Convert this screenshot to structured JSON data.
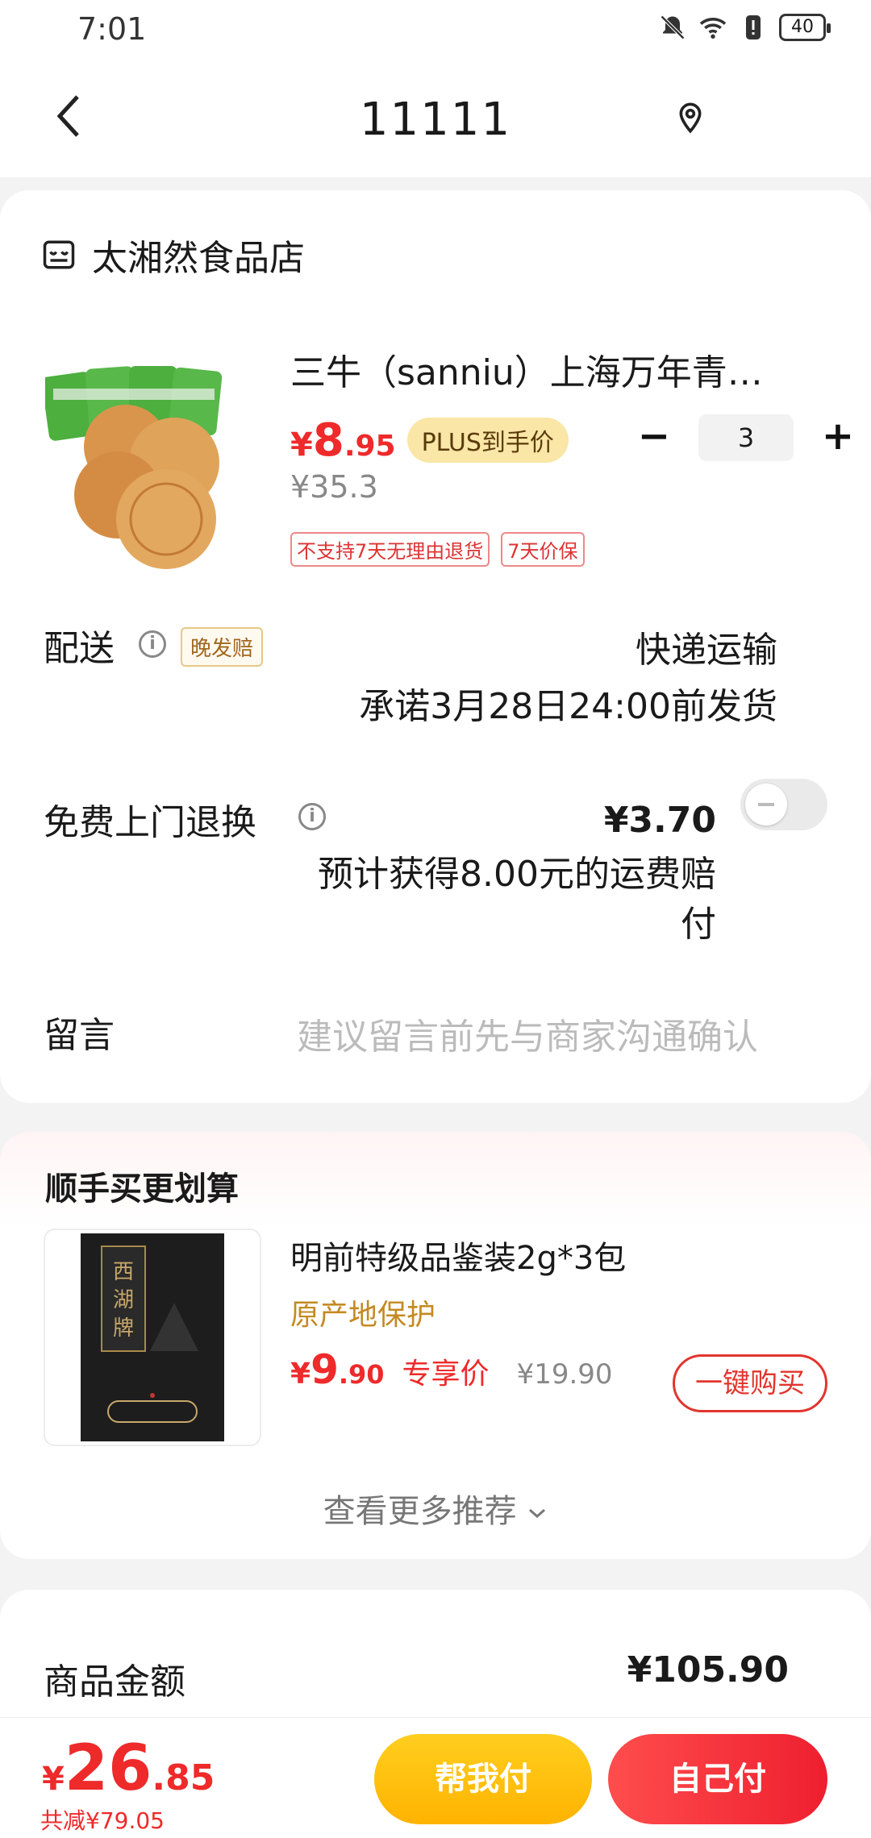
{
  "status_bar": {
    "time": "7:01",
    "battery": "40"
  },
  "nav": {
    "title": "11111"
  },
  "store": {
    "name": "太湘然食品店"
  },
  "product": {
    "title": "三牛（sanniu）上海万年青…",
    "price_currency": "¥",
    "price_int": "8",
    "price_dec": ".95",
    "plus_badge": "PLUS到手价",
    "original_price": "¥35.3",
    "quantity": "3",
    "minus": "−",
    "plus": "+",
    "tags": [
      "不支持7天无理由退货",
      "7天价保"
    ]
  },
  "delivery": {
    "label": "配送",
    "badge": "晚发赔",
    "method": "快递运输",
    "promise": "承诺3月28日24:00前发货"
  },
  "return_service": {
    "label": "免费上门退换",
    "price": "¥3.70",
    "note": "预计获得8.00元的运费赔付"
  },
  "message": {
    "label": "留言",
    "placeholder": "建议留言前先与商家沟通确认"
  },
  "recommend": {
    "section_title": "顺手买更划算",
    "title": "明前特级品鉴装2g*3包",
    "subtitle": "原产地保护",
    "price_currency": "¥",
    "price_int": "9",
    "price_dec": ".90",
    "exclusive": "专享价",
    "original_price": "¥19.90",
    "buy_button": "一键购买",
    "more": "查看更多推荐"
  },
  "summary": {
    "label": "商品金额",
    "value": "¥105.90"
  },
  "bottom": {
    "currency": "¥",
    "total_int": "26",
    "total_dec": ".85",
    "saved": "共减¥79.05",
    "help_pay": "帮我付",
    "self_pay": "自己付"
  },
  "colors": {
    "accent_red": "#ee2a2a",
    "gold": "#ffb300",
    "plus_badge_bg": "#fae6a6"
  },
  "icons": [
    "back-icon",
    "location-icon",
    "store-icon",
    "info-icon",
    "chevron-down-icon",
    "mute-icon",
    "wifi-icon",
    "alert-icon",
    "battery-icon"
  ]
}
